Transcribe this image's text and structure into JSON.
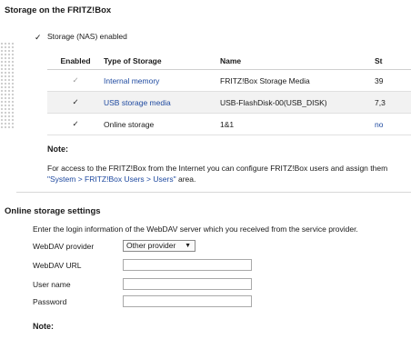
{
  "storage": {
    "title": "Storage on the FRITZ!Box",
    "nas_label": "Storage (NAS) enabled",
    "table": {
      "headers": [
        "Enabled",
        "Type of Storage",
        "Name",
        "St"
      ],
      "rows": [
        {
          "enabled": "✓",
          "type": "Internal memory",
          "name": "FRITZ!Box Storage Media",
          "status": "39"
        },
        {
          "enabled": "✓",
          "type": "USB storage media",
          "name": "USB-FlashDisk-00(USB_DISK)",
          "status": "7,3"
        },
        {
          "enabled": "✓",
          "type": "Online storage",
          "name": "1&1",
          "status": "no"
        }
      ]
    },
    "note_title": "Note:",
    "note_text_1": "For access to the FRITZ!Box from the Internet you can configure FRITZ!Box users and assign them",
    "note_link": "\"System > FRITZ!Box Users > Users\"",
    "note_text_2": "area."
  },
  "online": {
    "title": "Online storage settings",
    "intro": "Enter the login information of the WebDAV server which you received from the service provider.",
    "provider_label": "WebDAV provider",
    "provider_value": "Other provider",
    "url_label": "WebDAV URL",
    "url_value": "",
    "user_label": "User name",
    "user_value": "",
    "password_label": "Password",
    "password_value": "",
    "note_title": "Note:"
  }
}
